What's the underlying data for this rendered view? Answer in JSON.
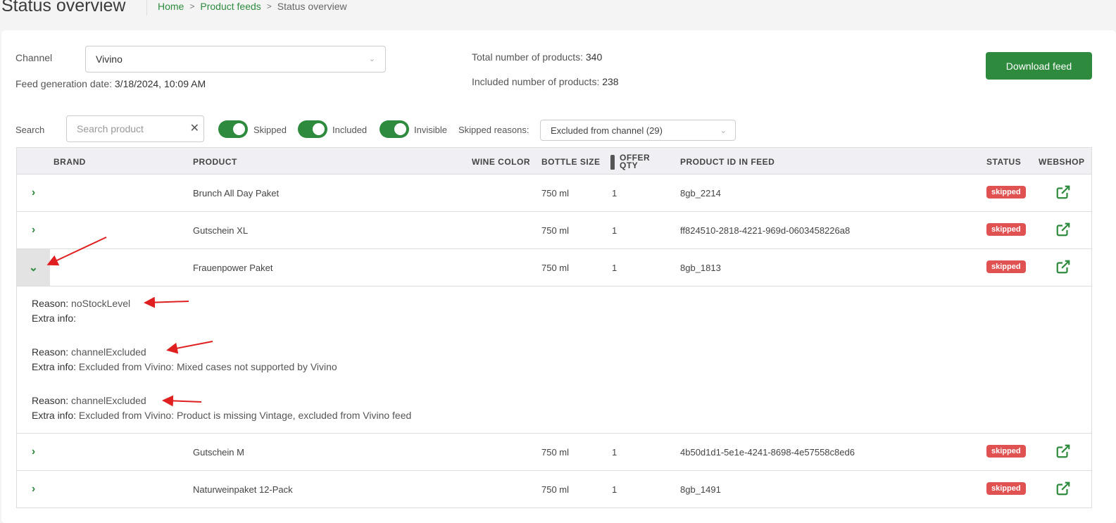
{
  "header": {
    "title": "Status overview",
    "breadcrumb": [
      "Home",
      "Product feeds",
      "Status overview"
    ]
  },
  "channel": {
    "label": "Channel",
    "value": "Vivino"
  },
  "feed_date": {
    "label": "Feed generation date:",
    "value": "3/18/2024, 10:09 AM"
  },
  "totals": {
    "total_label": "Total number of products:",
    "total_value": "340",
    "included_label": "Included number of products:",
    "included_value": "238"
  },
  "download_button": "Download feed",
  "filters": {
    "search_label": "Search",
    "search_placeholder": "Search product",
    "toggles": [
      "Skipped",
      "Included",
      "Invisible"
    ],
    "skipped_reasons_label": "Skipped reasons:",
    "skipped_reasons_value": "Excluded from channel (29)"
  },
  "table": {
    "columns": [
      "BRAND",
      "PRODUCT",
      "WINE COLOR",
      "BOTTLE SIZE",
      "OFFER QTY",
      "PRODUCT ID IN FEED",
      "STATUS",
      "WEBSHOP"
    ],
    "rows": [
      {
        "product": "Brunch All Day Paket",
        "bottle_size": "750 ml",
        "qty": "1",
        "feed_id": "8gb_2214",
        "status": "skipped"
      },
      {
        "product": "Gutschein XL",
        "bottle_size": "750 ml",
        "qty": "1",
        "feed_id": "ff824510-2818-4221-969d-0603458226a8",
        "status": "skipped"
      },
      {
        "product": "Frauenpower Paket",
        "bottle_size": "750 ml",
        "qty": "1",
        "feed_id": "8gb_1813",
        "status": "skipped"
      },
      {
        "product": "Gutschein M",
        "bottle_size": "750 ml",
        "qty": "1",
        "feed_id": "4b50d1d1-5e1e-4241-8698-4e57558c8ed6",
        "status": "skipped"
      },
      {
        "product": "Naturweinpaket 12-Pack",
        "bottle_size": "750 ml",
        "qty": "1",
        "feed_id": "8gb_1491",
        "status": "skipped"
      }
    ],
    "details": {
      "reason_label": "Reason:",
      "extra_label": "Extra info:",
      "items": [
        {
          "reason": "noStockLevel",
          "extra": ""
        },
        {
          "reason": "channelExcluded",
          "extra": "Excluded from Vivino: Mixed cases not supported by Vivino"
        },
        {
          "reason": "channelExcluded",
          "extra": "Excluded from Vivino: Product is missing Vintage, excluded from Vivino feed"
        }
      ]
    }
  },
  "colors": {
    "accent": "#2e8b3e",
    "badge": "#e05252",
    "annotation_arrow": "#e02020"
  }
}
